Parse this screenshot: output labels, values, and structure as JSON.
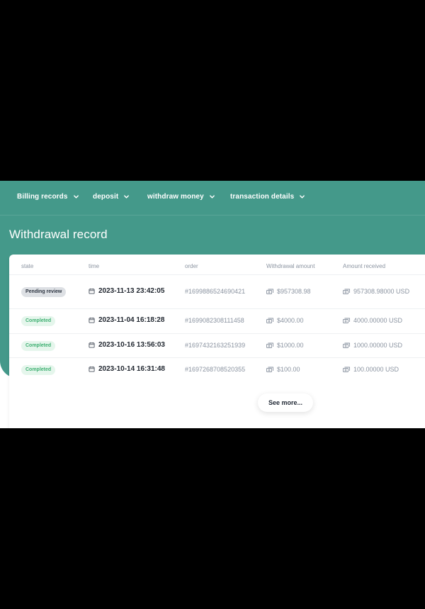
{
  "nav": {
    "items": [
      {
        "label": "Billing records",
        "icon": "chevron-down-icon"
      },
      {
        "label": "deposit",
        "icon": "chevron-down-icon"
      },
      {
        "label": "withdraw money",
        "icon": "chevron-down-icon"
      },
      {
        "label": "transaction details",
        "icon": "chevron-down-icon"
      }
    ]
  },
  "page": {
    "title": "Withdrawal record"
  },
  "table": {
    "columns": [
      "state",
      "time",
      "order",
      "Withdrawal amount",
      "Amount received"
    ],
    "rows": [
      {
        "state": "Pending review",
        "state_kind": "pending",
        "time": "2023-11-13 23:42:05",
        "order": "#1699886524690421",
        "withdrawal_amount": "$957308.98",
        "amount_received": "957308.98000 USD"
      },
      {
        "state": "Completed",
        "state_kind": "completed",
        "time": "2023-11-04 16:18:28",
        "order": "#1699082308111458",
        "withdrawal_amount": "$4000.00",
        "amount_received": "4000.00000 USD"
      },
      {
        "state": "Completed",
        "state_kind": "completed",
        "time": "2023-10-16 13:56:03",
        "order": "#1697432163251939",
        "withdrawal_amount": "$1000.00",
        "amount_received": "1000.00000 USD"
      },
      {
        "state": "Completed",
        "state_kind": "completed",
        "time": "2023-10-14 16:31:48",
        "order": "#1697268708520355",
        "withdrawal_amount": "$100.00",
        "amount_received": "100.00000 USD"
      }
    ],
    "see_more_label": "See more..."
  },
  "colors": {
    "teal": "#44998a",
    "pending_badge_bg": "#dde0e4",
    "completed_badge_bg": "#e5f6ec",
    "completed_badge_text": "#3fb072"
  },
  "icons": {
    "time": "calendar-icon",
    "money": "bills-icon"
  }
}
